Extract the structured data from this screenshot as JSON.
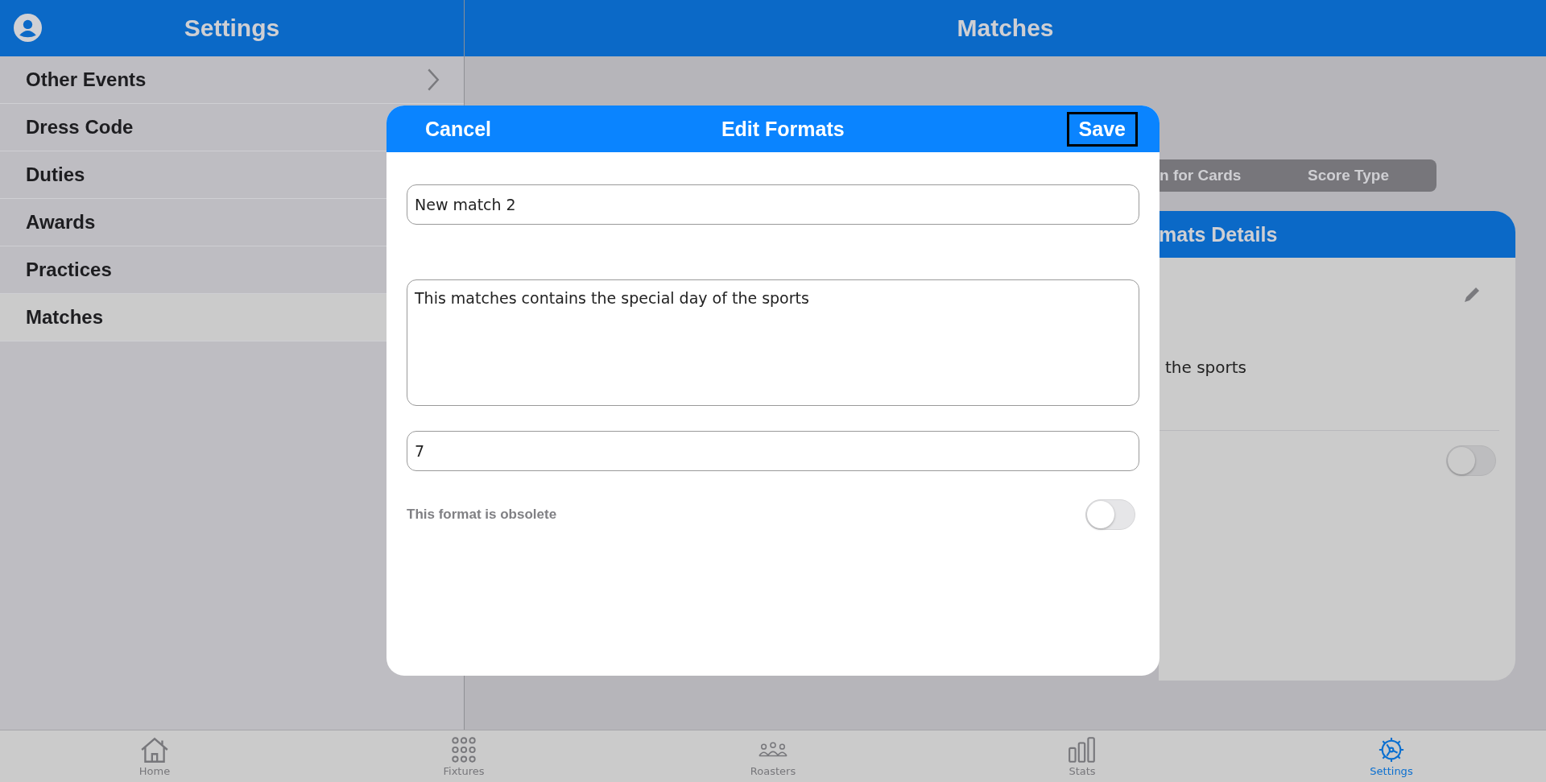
{
  "header": {
    "left_title": "Settings",
    "right_title": "Matches"
  },
  "sidebar": {
    "items": [
      {
        "label": "Other Events",
        "selected": false,
        "chevron": true
      },
      {
        "label": "Dress Code",
        "selected": false
      },
      {
        "label": "Duties",
        "selected": false
      },
      {
        "label": "Awards",
        "selected": false
      },
      {
        "label": "Practices",
        "selected": false
      },
      {
        "label": "Matches",
        "selected": true
      }
    ]
  },
  "background": {
    "segments": [
      "n for Cards",
      "Score Type"
    ],
    "card_title": "mats Details",
    "description_fragment": "the sports",
    "toggle_on": false
  },
  "dialog": {
    "cancel": "Cancel",
    "title": "Edit Formats",
    "save": "Save",
    "name_value": "New match 2",
    "description_value": "This matches contains the special day of the sports",
    "number_value": "7",
    "obsolete_label": "This format is obsolete",
    "obsolete_on": false
  },
  "tabbar": [
    {
      "kind": "home",
      "label": "Home",
      "selected": false
    },
    {
      "kind": "grid",
      "label": "Fixtures",
      "selected": false
    },
    {
      "kind": "people",
      "label": "Roasters",
      "selected": false
    },
    {
      "kind": "stats",
      "label": "Stats",
      "selected": false
    },
    {
      "kind": "gear",
      "label": "Settings",
      "selected": true
    }
  ]
}
